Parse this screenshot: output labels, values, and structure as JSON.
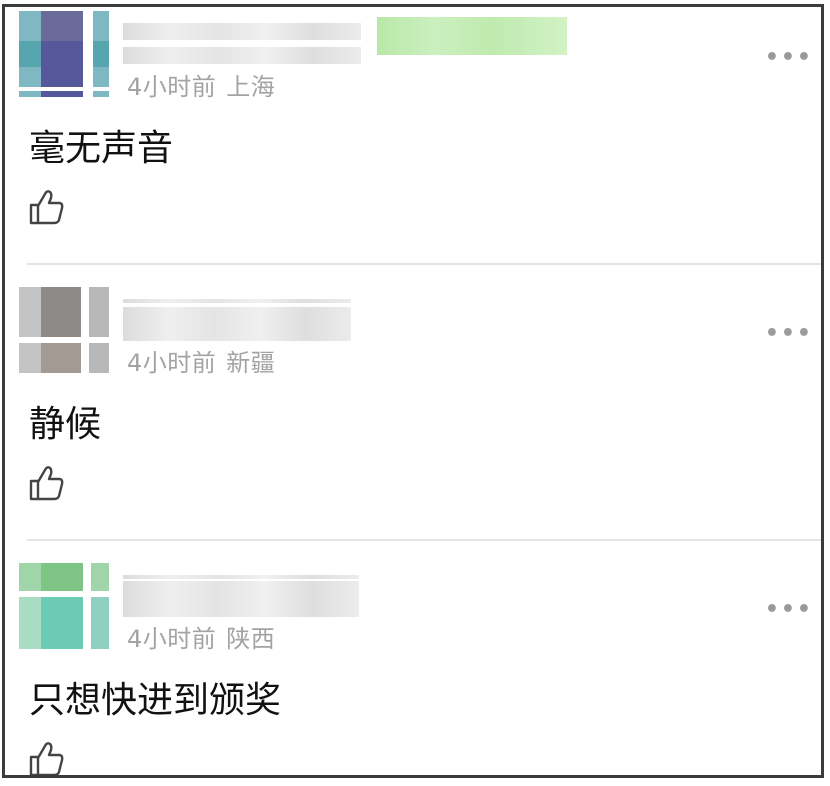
{
  "comments": [
    {
      "time": "4小时前",
      "location": "上海",
      "text": "毫无声音",
      "avatar_colors": [
        "#8fc3cc",
        "#6b6e99",
        "#59a5ad",
        "#5a5f92"
      ],
      "badge_color": "#c3ecb3"
    },
    {
      "time": "4小时前",
      "location": "新疆",
      "text": "静候",
      "avatar_colors": [
        "#bcbcbc",
        "#8f8a87",
        "#c7c7c7",
        "#a09890"
      ],
      "badge_color": ""
    },
    {
      "time": "4小时前",
      "location": "陕西",
      "text": "只想快进到颁奖",
      "avatar_colors": [
        "#a7d9a4",
        "#78c389",
        "#bfe3c6",
        "#6ccbb5"
      ],
      "badge_color": ""
    }
  ],
  "icons": {
    "more": "more-icon",
    "like": "thumbs-up-icon"
  }
}
